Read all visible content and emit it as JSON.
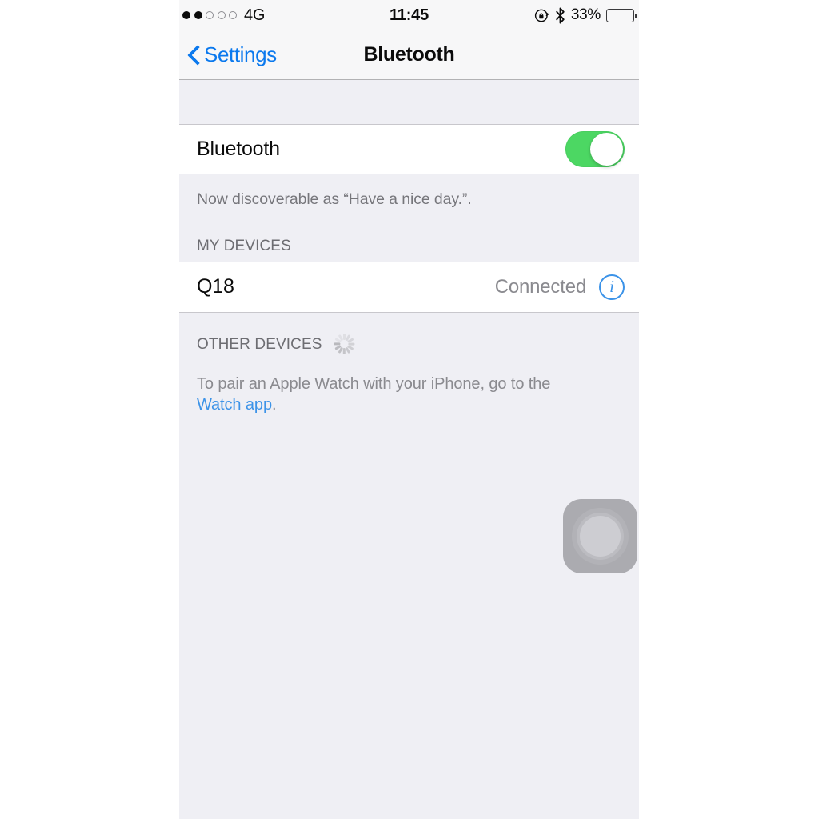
{
  "status_bar": {
    "signal_dots_filled": 2,
    "signal_dots_total": 5,
    "carrier": "4G",
    "time": "11:45",
    "rotation_lock_icon": "rotation-lock-icon",
    "bluetooth_icon": "bluetooth-icon",
    "battery_percent": "33%",
    "battery_level": 33,
    "battery_color": "#fbc400"
  },
  "nav_bar": {
    "back_label": "Settings",
    "title": "Bluetooth"
  },
  "bluetooth_row": {
    "label": "Bluetooth",
    "toggle_state": "on",
    "toggle_on_color": "#4cd763"
  },
  "discoverable_note": "Now discoverable as “Have a nice day.”.",
  "my_devices": {
    "header": "MY DEVICES",
    "items": [
      {
        "name": "Q18",
        "status": "Connected",
        "info_icon": "info-circle-icon"
      }
    ]
  },
  "other_devices": {
    "header": "OTHER DEVICES",
    "spinner": "activity-spinner-icon"
  },
  "footer": {
    "text_before_link": "To pair an Apple Watch with your iPhone, go to the ",
    "link_text": "Watch app",
    "text_after_link": ".",
    "link_color": "#3c93e8"
  },
  "assistive_touch": {
    "label": "assistive-touch-button"
  }
}
